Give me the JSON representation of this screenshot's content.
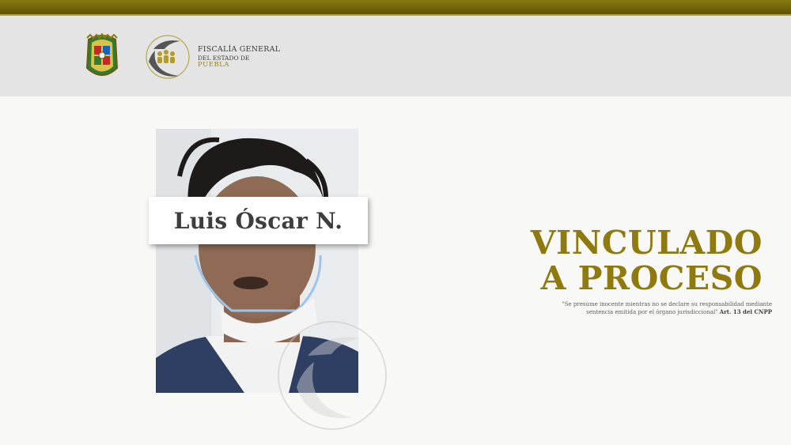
{
  "colors": {
    "gold": "#8f7a10",
    "top_bar": "#6f6109",
    "header_bg": "#e4e4e4",
    "text_dark": "#3d3d3d"
  },
  "header": {
    "seal_icon": "puebla-state-seal-icon",
    "logo_icon": "fiscalia-logo-icon",
    "agency_line1": "FISCALÍA GENERAL",
    "agency_line2": "DEL ESTADO DE",
    "agency_line3": "PUEBLA"
  },
  "person": {
    "name": "Luis Óscar N."
  },
  "status": {
    "line1": "VINCULADO",
    "line2": "A PROCESO"
  },
  "disclaimer": {
    "line1": "\"Se presume inocente mientras no se declare su responsabilidad mediante",
    "line2": "sentencia emitida por el órgano jurisdiccional\"",
    "article": "Art. 13 del CNPP"
  }
}
